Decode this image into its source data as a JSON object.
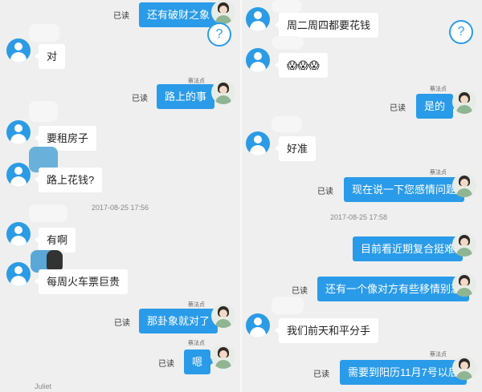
{
  "read_label": "已读",
  "sender_name": "蔡法贞",
  "left": {
    "messages": {
      "m1": "还有破财之象",
      "m2": "对",
      "m3": "路上的事",
      "m4": "要租房子",
      "m5": "路上花钱?",
      "m6": "有啊",
      "m7": "每周火车票巨贵",
      "m8": "那卦象就对了",
      "m9": "嗯"
    },
    "timestamp": "2017-08-25 17:56",
    "bottom_name": "Juliet"
  },
  "right": {
    "messages": {
      "m1": "周二周四都要花钱",
      "m2": "😱😱😱",
      "m3": "是的",
      "m4": "好准",
      "m5": "现在说一下您感情问题",
      "m6": "目前看近期复合挺难",
      "m7": "还有一个像对方有些移情别恋",
      "m8": "我们前天和平分手",
      "m9": "需要到阳历11月7号以后"
    },
    "timestamp": "2017-08-25 17:58"
  },
  "icons": {
    "help": "question-circle-icon",
    "user_avatar": "user-avatar-icon"
  },
  "colors": {
    "bubble_out": "#2a9be8",
    "bubble_in": "#ffffff",
    "background": "#efefef"
  }
}
